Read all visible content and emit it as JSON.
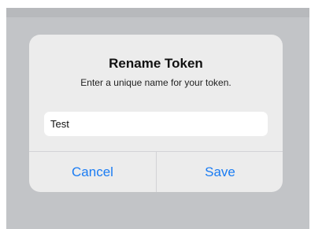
{
  "dialog": {
    "title": "Rename Token",
    "message": "Enter a unique name for your token.",
    "input": {
      "value": "Test"
    },
    "buttons": {
      "cancel": "Cancel",
      "save": "Save"
    }
  },
  "colors": {
    "accent": "#1a7cf3",
    "dialog_background": "#ececec",
    "backdrop": "#c2c4c7"
  }
}
